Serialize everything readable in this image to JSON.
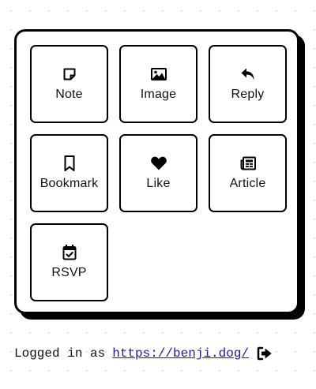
{
  "actions": [
    {
      "id": "note",
      "label": "Note",
      "icon": "note-icon"
    },
    {
      "id": "image",
      "label": "Image",
      "icon": "image-icon"
    },
    {
      "id": "reply",
      "label": "Reply",
      "icon": "reply-icon"
    },
    {
      "id": "bookmark",
      "label": "Bookmark",
      "icon": "bookmark-icon"
    },
    {
      "id": "like",
      "label": "Like",
      "icon": "heart-icon"
    },
    {
      "id": "article",
      "label": "Article",
      "icon": "newspaper-icon"
    },
    {
      "id": "rsvp",
      "label": "RSVP",
      "icon": "calendar-check-icon"
    }
  ],
  "footer": {
    "prefix": "Logged in as",
    "user_url": "https://benji.dog/",
    "logout_icon": "logout-icon"
  },
  "colors": {
    "border": "#000000",
    "background": "#ffffff",
    "link": "#1a1aa6",
    "dot_grid": "#dcdcdc"
  }
}
